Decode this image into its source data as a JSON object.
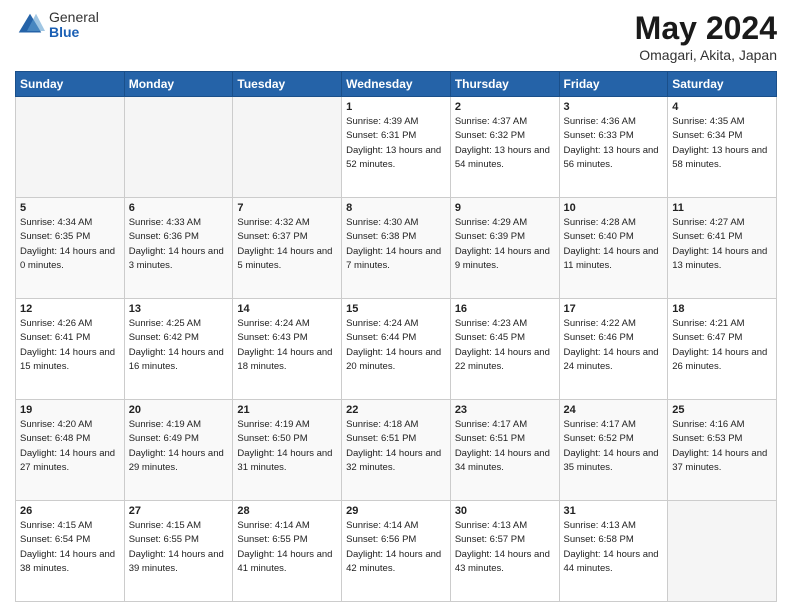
{
  "header": {
    "logo_general": "General",
    "logo_blue": "Blue",
    "month_title": "May 2024",
    "location": "Omagari, Akita, Japan"
  },
  "weekdays": [
    "Sunday",
    "Monday",
    "Tuesday",
    "Wednesday",
    "Thursday",
    "Friday",
    "Saturday"
  ],
  "weeks": [
    [
      {
        "day": "",
        "empty": true
      },
      {
        "day": "",
        "empty": true
      },
      {
        "day": "",
        "empty": true
      },
      {
        "day": "1",
        "sunrise": "Sunrise: 4:39 AM",
        "sunset": "Sunset: 6:31 PM",
        "daylight": "Daylight: 13 hours and 52 minutes."
      },
      {
        "day": "2",
        "sunrise": "Sunrise: 4:37 AM",
        "sunset": "Sunset: 6:32 PM",
        "daylight": "Daylight: 13 hours and 54 minutes."
      },
      {
        "day": "3",
        "sunrise": "Sunrise: 4:36 AM",
        "sunset": "Sunset: 6:33 PM",
        "daylight": "Daylight: 13 hours and 56 minutes."
      },
      {
        "day": "4",
        "sunrise": "Sunrise: 4:35 AM",
        "sunset": "Sunset: 6:34 PM",
        "daylight": "Daylight: 13 hours and 58 minutes."
      }
    ],
    [
      {
        "day": "5",
        "sunrise": "Sunrise: 4:34 AM",
        "sunset": "Sunset: 6:35 PM",
        "daylight": "Daylight: 14 hours and 0 minutes."
      },
      {
        "day": "6",
        "sunrise": "Sunrise: 4:33 AM",
        "sunset": "Sunset: 6:36 PM",
        "daylight": "Daylight: 14 hours and 3 minutes."
      },
      {
        "day": "7",
        "sunrise": "Sunrise: 4:32 AM",
        "sunset": "Sunset: 6:37 PM",
        "daylight": "Daylight: 14 hours and 5 minutes."
      },
      {
        "day": "8",
        "sunrise": "Sunrise: 4:30 AM",
        "sunset": "Sunset: 6:38 PM",
        "daylight": "Daylight: 14 hours and 7 minutes."
      },
      {
        "day": "9",
        "sunrise": "Sunrise: 4:29 AM",
        "sunset": "Sunset: 6:39 PM",
        "daylight": "Daylight: 14 hours and 9 minutes."
      },
      {
        "day": "10",
        "sunrise": "Sunrise: 4:28 AM",
        "sunset": "Sunset: 6:40 PM",
        "daylight": "Daylight: 14 hours and 11 minutes."
      },
      {
        "day": "11",
        "sunrise": "Sunrise: 4:27 AM",
        "sunset": "Sunset: 6:41 PM",
        "daylight": "Daylight: 14 hours and 13 minutes."
      }
    ],
    [
      {
        "day": "12",
        "sunrise": "Sunrise: 4:26 AM",
        "sunset": "Sunset: 6:41 PM",
        "daylight": "Daylight: 14 hours and 15 minutes."
      },
      {
        "day": "13",
        "sunrise": "Sunrise: 4:25 AM",
        "sunset": "Sunset: 6:42 PM",
        "daylight": "Daylight: 14 hours and 16 minutes."
      },
      {
        "day": "14",
        "sunrise": "Sunrise: 4:24 AM",
        "sunset": "Sunset: 6:43 PM",
        "daylight": "Daylight: 14 hours and 18 minutes."
      },
      {
        "day": "15",
        "sunrise": "Sunrise: 4:24 AM",
        "sunset": "Sunset: 6:44 PM",
        "daylight": "Daylight: 14 hours and 20 minutes."
      },
      {
        "day": "16",
        "sunrise": "Sunrise: 4:23 AM",
        "sunset": "Sunset: 6:45 PM",
        "daylight": "Daylight: 14 hours and 22 minutes."
      },
      {
        "day": "17",
        "sunrise": "Sunrise: 4:22 AM",
        "sunset": "Sunset: 6:46 PM",
        "daylight": "Daylight: 14 hours and 24 minutes."
      },
      {
        "day": "18",
        "sunrise": "Sunrise: 4:21 AM",
        "sunset": "Sunset: 6:47 PM",
        "daylight": "Daylight: 14 hours and 26 minutes."
      }
    ],
    [
      {
        "day": "19",
        "sunrise": "Sunrise: 4:20 AM",
        "sunset": "Sunset: 6:48 PM",
        "daylight": "Daylight: 14 hours and 27 minutes."
      },
      {
        "day": "20",
        "sunrise": "Sunrise: 4:19 AM",
        "sunset": "Sunset: 6:49 PM",
        "daylight": "Daylight: 14 hours and 29 minutes."
      },
      {
        "day": "21",
        "sunrise": "Sunrise: 4:19 AM",
        "sunset": "Sunset: 6:50 PM",
        "daylight": "Daylight: 14 hours and 31 minutes."
      },
      {
        "day": "22",
        "sunrise": "Sunrise: 4:18 AM",
        "sunset": "Sunset: 6:51 PM",
        "daylight": "Daylight: 14 hours and 32 minutes."
      },
      {
        "day": "23",
        "sunrise": "Sunrise: 4:17 AM",
        "sunset": "Sunset: 6:51 PM",
        "daylight": "Daylight: 14 hours and 34 minutes."
      },
      {
        "day": "24",
        "sunrise": "Sunrise: 4:17 AM",
        "sunset": "Sunset: 6:52 PM",
        "daylight": "Daylight: 14 hours and 35 minutes."
      },
      {
        "day": "25",
        "sunrise": "Sunrise: 4:16 AM",
        "sunset": "Sunset: 6:53 PM",
        "daylight": "Daylight: 14 hours and 37 minutes."
      }
    ],
    [
      {
        "day": "26",
        "sunrise": "Sunrise: 4:15 AM",
        "sunset": "Sunset: 6:54 PM",
        "daylight": "Daylight: 14 hours and 38 minutes."
      },
      {
        "day": "27",
        "sunrise": "Sunrise: 4:15 AM",
        "sunset": "Sunset: 6:55 PM",
        "daylight": "Daylight: 14 hours and 39 minutes."
      },
      {
        "day": "28",
        "sunrise": "Sunrise: 4:14 AM",
        "sunset": "Sunset: 6:55 PM",
        "daylight": "Daylight: 14 hours and 41 minutes."
      },
      {
        "day": "29",
        "sunrise": "Sunrise: 4:14 AM",
        "sunset": "Sunset: 6:56 PM",
        "daylight": "Daylight: 14 hours and 42 minutes."
      },
      {
        "day": "30",
        "sunrise": "Sunrise: 4:13 AM",
        "sunset": "Sunset: 6:57 PM",
        "daylight": "Daylight: 14 hours and 43 minutes."
      },
      {
        "day": "31",
        "sunrise": "Sunrise: 4:13 AM",
        "sunset": "Sunset: 6:58 PM",
        "daylight": "Daylight: 14 hours and 44 minutes."
      },
      {
        "day": "",
        "empty": true
      }
    ]
  ]
}
